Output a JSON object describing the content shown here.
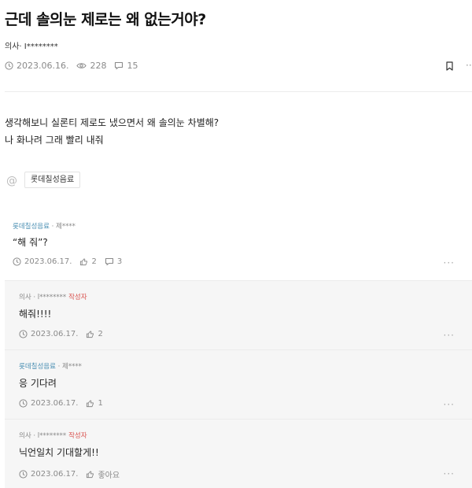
{
  "post": {
    "title": "근데 솔의눈 제로는 왜 없는거야?",
    "author": "의사· I********",
    "date": "2023.06.16.",
    "views": "228",
    "comments": "15",
    "more": "···",
    "body_lines": [
      "생각해보니 실론티 제로도 냈으면서 왜 솔의눈 차별해?",
      "나 화나려 그래 빨리 내줘"
    ],
    "tag": "롯데칠성음료"
  },
  "comments": [
    {
      "author_company": "롯데칠성음료",
      "author_sep": " · 제****",
      "op_badge": "",
      "body": "“해 줘”?",
      "date": "2023.06.17.",
      "likes": "2",
      "replies": "3",
      "more": "···"
    },
    {
      "author_company": "의사 · l********",
      "author_sep": "",
      "op_badge": "작성자",
      "body": "해줘!!!!",
      "date": "2023.06.17.",
      "likes": "2",
      "more": "···"
    },
    {
      "author_company": "롯데칠성음료",
      "author_sep": " · 제****",
      "op_badge": "",
      "body": "응 기다려",
      "date": "2023.06.17.",
      "likes": "1",
      "more": "···"
    },
    {
      "author_company": "의사 · l********",
      "author_sep": "",
      "op_badge": "작성자",
      "body": "닉언일치 기대할게!!",
      "date": "2023.06.17.",
      "likes": "좋아요",
      "more": "···"
    }
  ],
  "icons": {
    "clock": "clock-icon",
    "eye": "eye-icon",
    "comment": "comment-icon",
    "bookmark": "bookmark-icon",
    "thumb": "thumbs-up-icon",
    "at": "at-icon"
  },
  "colors": {
    "company_link": "#4a8fb3",
    "op_badge": "#d9534f",
    "reply_bg": "#f6f6f6"
  }
}
